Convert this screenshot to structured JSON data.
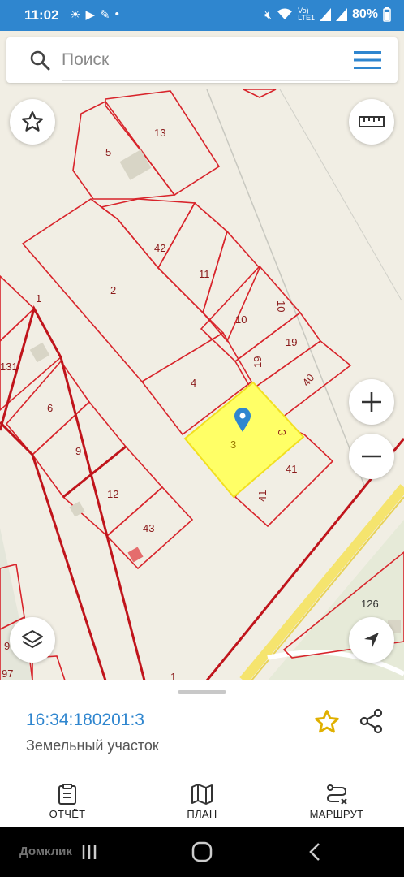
{
  "status_bar": {
    "time": "11:02",
    "battery": "80%",
    "left_icons": [
      "sun-icon",
      "youtube-icon",
      "broom-icon",
      "dot-icon"
    ],
    "right_icons": [
      "mute-icon",
      "wifi-icon",
      "volte-icon",
      "signal-icon",
      "signal2-icon"
    ]
  },
  "search": {
    "placeholder": "Поиск"
  },
  "map": {
    "parcels": [
      "13",
      "5",
      "42",
      "11",
      "2",
      "1",
      "10",
      "10",
      "19",
      "19",
      "131",
      "4",
      "40",
      "6",
      "3",
      "3",
      "41",
      "41",
      "9",
      "12",
      "43",
      "126",
      "9",
      "97",
      "1"
    ],
    "selected_parcel_color": "#ffff66",
    "boundary_color": "#d8242b"
  },
  "sheet": {
    "cadastral_number": "16:34:180201:3",
    "parcel_type": "Земельный участок",
    "star_color": "#f2c200"
  },
  "toolbar": {
    "report_label": "ОТЧЁТ",
    "plan_label": "ПЛАН",
    "route_label": "МАРШРУТ"
  },
  "nav": {
    "watermark": "Домклик"
  },
  "colors": {
    "accent": "#2f86cf"
  }
}
